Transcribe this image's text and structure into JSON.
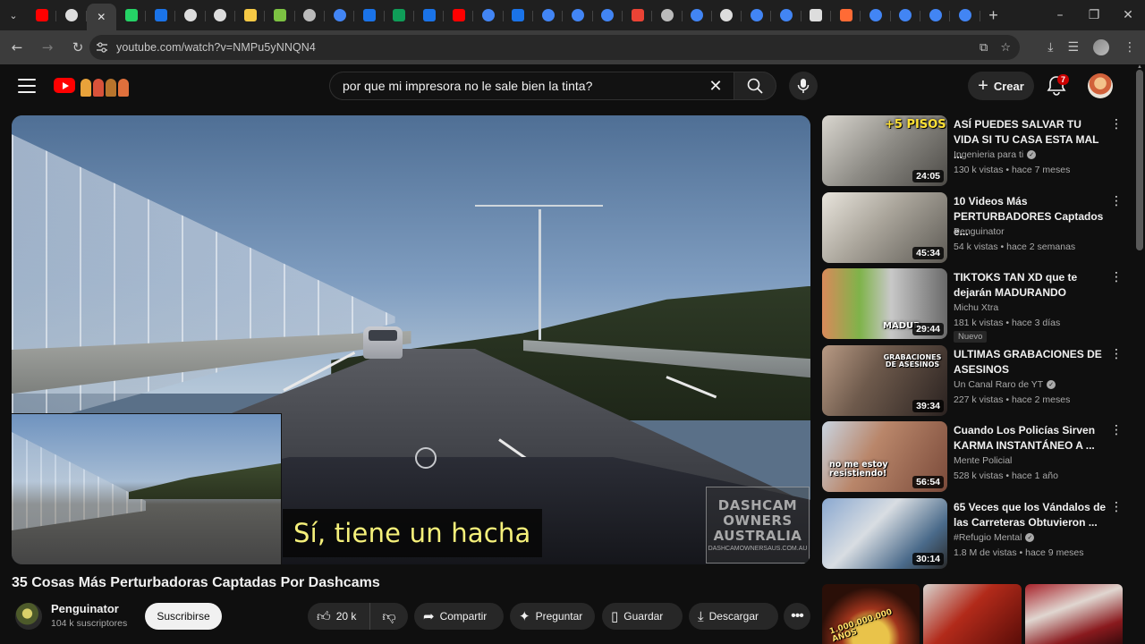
{
  "browser": {
    "tabs": [
      {
        "icon": "youtube-icon",
        "color": "#ff0000"
      },
      {
        "icon": "chatgpt-icon",
        "color": "#dddddd"
      },
      {
        "icon": "close-icon",
        "active": true
      },
      {
        "icon": "whatsapp-icon",
        "color": "#25d366"
      },
      {
        "icon": "app-blue-icon",
        "color": "#1a73e8"
      },
      {
        "icon": "chatgpt-icon",
        "color": "#dddddd"
      },
      {
        "icon": "chatgpt-icon",
        "color": "#dddddd"
      },
      {
        "icon": "notes-icon",
        "color": "#f6c945"
      },
      {
        "icon": "arrow-app-icon",
        "color": "#7cc242"
      },
      {
        "icon": "globe-icon",
        "color": "#bbbbbb"
      },
      {
        "icon": "google-icon",
        "color": "#4285f4"
      },
      {
        "icon": "bbc-icon",
        "color": "#1a73e8"
      },
      {
        "icon": "sheets-icon",
        "color": "#0f9d58"
      },
      {
        "icon": "bbc-icon",
        "color": "#1a73e8"
      },
      {
        "icon": "youtube-icon",
        "color": "#ff0000"
      },
      {
        "icon": "google-icon",
        "color": "#4285f4"
      },
      {
        "icon": "bbc-icon",
        "color": "#1a73e8"
      },
      {
        "icon": "google-icon",
        "color": "#4285f4"
      },
      {
        "icon": "google-icon",
        "color": "#4285f4"
      },
      {
        "icon": "google-icon",
        "color": "#4285f4"
      },
      {
        "icon": "gmail-icon",
        "color": "#ea4335"
      },
      {
        "icon": "settings-icon",
        "color": "#bbbbbb"
      },
      {
        "icon": "google-icon",
        "color": "#4285f4"
      },
      {
        "icon": "chatgpt-icon",
        "color": "#dddddd"
      },
      {
        "icon": "google-icon",
        "color": "#4285f4"
      },
      {
        "icon": "google-icon",
        "color": "#4285f4"
      },
      {
        "icon": "square-app-icon",
        "color": "#dddddd"
      },
      {
        "icon": "b-app-icon",
        "color": "#ff6b35"
      },
      {
        "icon": "google-icon",
        "color": "#4285f4"
      },
      {
        "icon": "google-icon",
        "color": "#4285f4"
      },
      {
        "icon": "google-icon",
        "color": "#4285f4"
      },
      {
        "icon": "google-icon",
        "color": "#4285f4"
      }
    ],
    "url": "youtube.com/watch?v=NMPu5yNNQN4"
  },
  "header": {
    "search_value": "por que mi impresora no le sale bien la tinta?",
    "create_label": "Crear",
    "notification_count": "7",
    "accent": "#ff0000"
  },
  "player": {
    "subtitle": "Sí, tiene un hacha",
    "watermark": [
      "DASHCAM",
      "OWNERS",
      "AUSTRALIA"
    ],
    "watermark_url": "DASHCAMOWNERSAUS.COM.AU"
  },
  "video": {
    "title": "35 Cosas Más Perturbadoras Captadas Por Dashcams",
    "channel": "Penguinator",
    "subscribers": "104 k suscriptores",
    "subscribe_label": "Suscribirse",
    "likes": "20 k",
    "share_label": "Compartir",
    "ask_label": "Preguntar",
    "save_label": "Guardar",
    "download_label": "Descargar"
  },
  "sidebar": {
    "items": [
      {
        "title": "ASÍ PUEDES SALVAR TU VIDA SI TU CASA ESTA MAL ...",
        "channel": "Ingenieria para ti",
        "verified": true,
        "meta": "130 k vistas • hace 7 meses",
        "duration": "24:05",
        "overlay": "+5 PISOS",
        "badge": ""
      },
      {
        "title": "10 Videos Más PERTURBADORES Captados e...",
        "channel": "Penguinator",
        "verified": false,
        "meta": "54 k vistas • hace 2 semanas",
        "duration": "45:34",
        "overlay": "",
        "badge": ""
      },
      {
        "title": "TIKTOKS TAN XD que te dejarán MADURANDO",
        "channel": "Michu Xtra",
        "verified": false,
        "meta": "181 k vistas • hace 3 días",
        "duration": "29:44",
        "overlay": "MADUR",
        "badge": "Nuevo"
      },
      {
        "title": "ULTIMAS GRABACIONES DE ASESINOS",
        "channel": "Un Canal Raro de YT",
        "verified": true,
        "meta": "227 k vistas • hace 2 meses",
        "duration": "39:34",
        "overlay": "GRABACIONES DE ASESINOS",
        "badge": ""
      },
      {
        "title": "Cuando Los Policías Sirven KARMA INSTANTÁNEO A ...",
        "channel": "Mente Policial",
        "verified": false,
        "meta": "528 k vistas • hace 1 año",
        "duration": "56:54",
        "overlay": "no me estoy resistiendo!",
        "badge": ""
      },
      {
        "title": "65 Veces que los Vándalos de las Carreteras Obtuvieron ...",
        "channel": "#Refugio Mental",
        "verified": true,
        "meta": "1.8 M de vistas • hace 9 meses",
        "duration": "30:14",
        "overlay": "",
        "badge": ""
      }
    ],
    "shorts_overlay": "1.000.000.000 AÑOS"
  }
}
